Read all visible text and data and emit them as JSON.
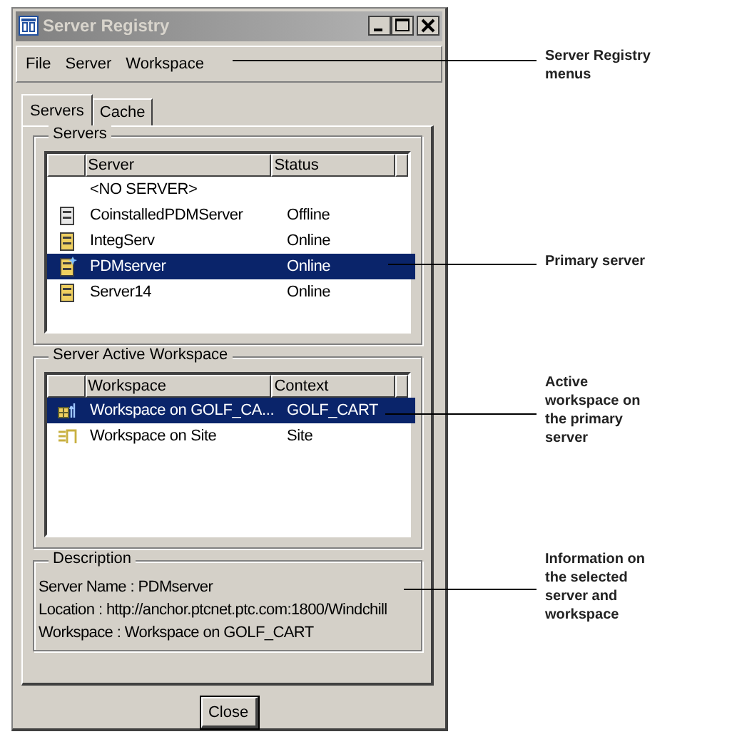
{
  "window": {
    "title": "Server Registry"
  },
  "menus": [
    "File",
    "Server",
    "Workspace"
  ],
  "tabs": [
    {
      "label": "Servers",
      "selected": true
    },
    {
      "label": "Cache",
      "selected": false
    }
  ],
  "servers": {
    "title": "Servers",
    "columns": [
      "Server",
      "Status"
    ],
    "rows": [
      {
        "name": "<NO SERVER>",
        "kind": "none",
        "selected": false
      },
      {
        "name": "CoinstalledPDMServer",
        "status": "Offline",
        "kind": "offline",
        "selected": false
      },
      {
        "name": "IntegServ",
        "status": "Online",
        "kind": "online",
        "selected": false
      },
      {
        "name": "PDMserver",
        "status": "Online",
        "kind": "primary",
        "selected": true
      },
      {
        "name": "Server14",
        "status": "Online",
        "kind": "online",
        "selected": false
      }
    ]
  },
  "workspace": {
    "title": "Server Active Workspace",
    "columns": [
      "Workspace",
      "Context"
    ],
    "rows": [
      {
        "name": "Workspace on GOLF_CA...",
        "context": "GOLF_CART",
        "kind": "active",
        "selected": true
      },
      {
        "name": "Workspace on Site",
        "context": "Site",
        "kind": "normal",
        "selected": false
      }
    ]
  },
  "description": {
    "title": "Description",
    "lines": [
      "Server Name : PDMserver",
      "Location : http://anchor.ptcnet.ptc.com:1800/Windchill",
      "Workspace : Workspace on GOLF_CART"
    ]
  },
  "buttons": [
    "Close"
  ],
  "callouts": [
    {
      "lines": [
        "Server Registry",
        "menus"
      ]
    },
    {
      "lines": [
        "Primary server"
      ]
    },
    {
      "lines": [
        "Active",
        "workspace on",
        "the primary",
        "server"
      ]
    },
    {
      "lines": [
        "Information on",
        "the selected",
        "server and",
        "workspace"
      ]
    }
  ]
}
